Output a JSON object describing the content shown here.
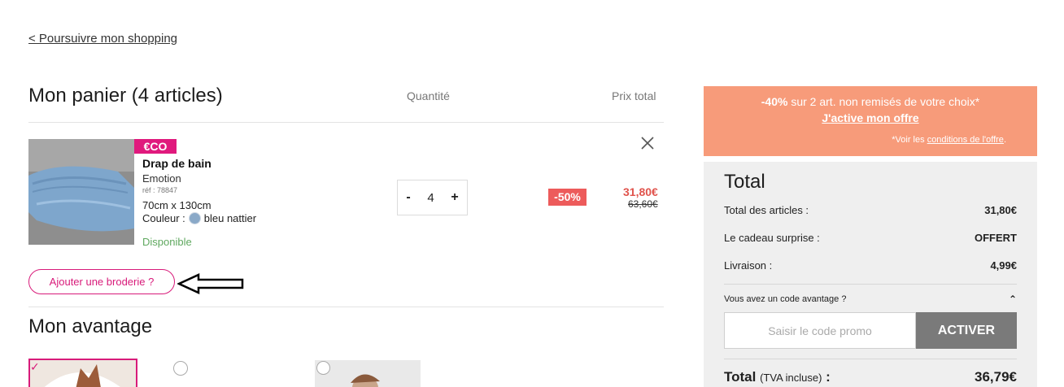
{
  "nav": {
    "back_label": "< Poursuivre mon shopping"
  },
  "cart": {
    "title": "Mon panier (4 articles)",
    "col_quantity": "Quantité",
    "col_total_price": "Prix total"
  },
  "product": {
    "badge": "€CO",
    "name": "Drap de bain",
    "brand": "Emotion",
    "ref": "réf : 78847",
    "size": "70cm x 130cm",
    "color_label": "Couleur :",
    "color_value": "bleu nattier",
    "color_swatch": "#8aa9c8",
    "availability": "Disponible",
    "qty_minus": "-",
    "qty_value": "4",
    "qty_plus": "+",
    "discount": "-50%",
    "price_new": "31,80€",
    "price_old": "63,60€"
  },
  "embroidery": {
    "label": "Ajouter une broderie ?"
  },
  "advantage": {
    "title": "Mon avantage"
  },
  "promo": {
    "percent": "-40%",
    "text": " sur 2 art. non remisés de votre choix*",
    "cta": "J'active mon offre",
    "terms_prefix": "*Voir les ",
    "terms_link": "conditions de l'offre",
    "terms_suffix": "."
  },
  "summary": {
    "title": "Total",
    "rows": [
      {
        "label": "Total des articles :",
        "value": "31,80€"
      },
      {
        "label": "Le cadeau surprise :",
        "value": "OFFERT"
      },
      {
        "label": "Livraison :",
        "value": "4,99€"
      }
    ],
    "code_question": "Vous avez un code avantage ?",
    "code_placeholder": "Saisir le code promo",
    "code_button": "ACTIVER",
    "total_label": "Total",
    "total_tax": "(TVA incluse)",
    "total_colon": " :",
    "total_value": "36,79€"
  },
  "colors": {
    "accent_pink": "#d81b7a",
    "promo_bg": "#f79b7a",
    "discount_red": "#ed5b5b",
    "available_green": "#5fa85f"
  }
}
